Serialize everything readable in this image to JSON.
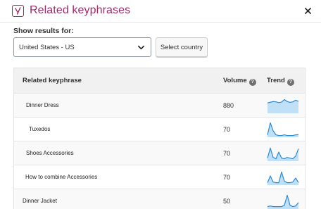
{
  "header": {
    "title": "Related keyphrases",
    "close_icon": "close-icon"
  },
  "filter": {
    "label": "Show results for:",
    "country_value": "United States - US",
    "select_country_label": "Select country"
  },
  "table": {
    "columns": {
      "keyphrase": "Related keyphrase",
      "volume": "Volume",
      "trend": "Trend"
    },
    "rows": [
      {
        "keyphrase": "Dinner Dress",
        "volume": "880",
        "trend": [
          0.7,
          0.75,
          0.8,
          0.78,
          0.72,
          0.76,
          0.95,
          0.8,
          0.74,
          0.78,
          0.9,
          0.82
        ]
      },
      {
        "keyphrase": "Tuxedos",
        "volume": "70",
        "trend": [
          0.1,
          1.0,
          0.4,
          0.1,
          0.05,
          0.05,
          0.1,
          0.05,
          0.05,
          0.05,
          0.1,
          0.12
        ]
      },
      {
        "keyphrase": "Shoes Accessories",
        "volume": "70",
        "trend": [
          0.15,
          0.9,
          0.2,
          0.1,
          0.6,
          0.15,
          0.1,
          0.2,
          0.15,
          0.1,
          0.3,
          0.85
        ]
      },
      {
        "keyphrase": "How to combine Accessories",
        "volume": "70",
        "trend": [
          0.1,
          0.6,
          0.15,
          0.1,
          0.1,
          0.9,
          0.2,
          0.1,
          0.1,
          0.15,
          0.45,
          0.1
        ]
      },
      {
        "keyphrase": "Dinner Jacket",
        "volume": "50",
        "trend": [
          0.1,
          0.15,
          0.1,
          0.1,
          0.1,
          0.1,
          0.2,
          0.95,
          0.2,
          0.1,
          0.15,
          0.4
        ]
      }
    ]
  },
  "colors": {
    "brand": "#a4286a",
    "trend_line": "#2a8ad6",
    "trend_fill": "#bfe0f7"
  }
}
